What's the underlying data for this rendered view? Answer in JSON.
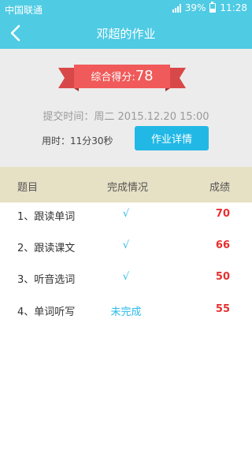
{
  "status_bar": {
    "carrier": "中国联通",
    "battery": "39%",
    "battery_level": 0.39,
    "time": "11:28"
  },
  "header": {
    "title": "邓超的作业",
    "back_icon": "chevron-left-icon"
  },
  "summary": {
    "score_label": "综合得分:",
    "score_value": "78",
    "submit_time": "提交时间：周二 2015.12.20  15:00",
    "duration": "用时：11分30秒",
    "detail_button": "作业详情"
  },
  "table": {
    "headers": [
      "题目",
      "完成情况",
      "成绩"
    ],
    "rows": [
      {
        "name": "1、跟读单词",
        "status": "√",
        "score": "70"
      },
      {
        "name": "2、跟读课文",
        "status": "√",
        "score": "66"
      },
      {
        "name": "3、听音选词",
        "status": "√",
        "score": "50"
      },
      {
        "name": "4、单词听写",
        "status": "未完成",
        "score": "55"
      }
    ]
  },
  "colors": {
    "header_bg": "#4fcbe4",
    "ribbon": "#f05a5a",
    "button": "#21b8e6",
    "score": "#e53030",
    "status": "#2bbbe8"
  }
}
